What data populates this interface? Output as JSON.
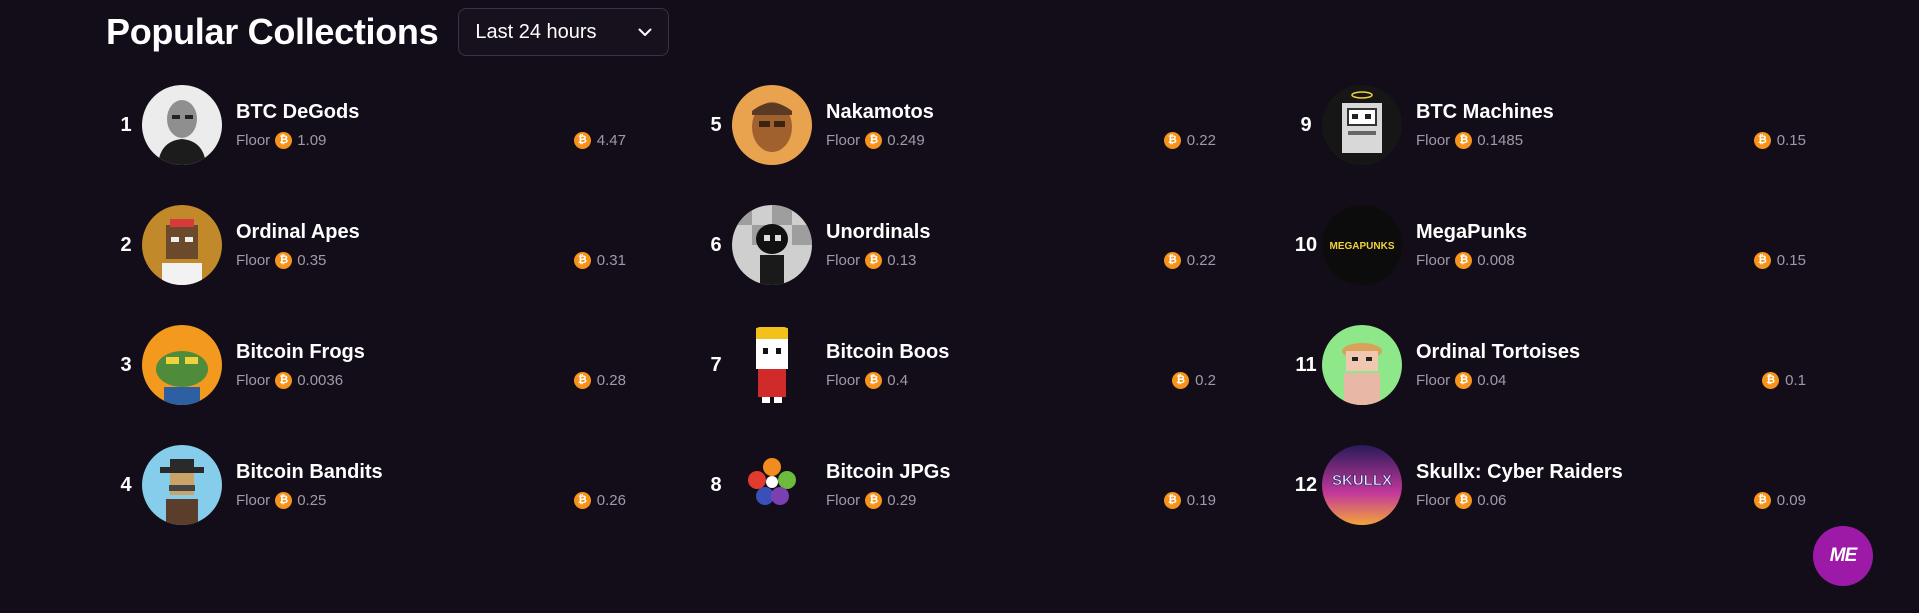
{
  "page": {
    "title": "Popular Collections"
  },
  "filter": {
    "selected": "Last 24 hours",
    "icon": "chevron-down-icon"
  },
  "currency_icon": "bitcoin-icon",
  "accent": "#f7931a",
  "collections": [
    {
      "rank": "1",
      "name": "BTC DeGods",
      "floor_label": "Floor",
      "floor": "1.09",
      "volume": "4.47"
    },
    {
      "rank": "2",
      "name": "Ordinal Apes",
      "floor_label": "Floor",
      "floor": "0.35",
      "volume": "0.31"
    },
    {
      "rank": "3",
      "name": "Bitcoin Frogs",
      "floor_label": "Floor",
      "floor": "0.0036",
      "volume": "0.28"
    },
    {
      "rank": "4",
      "name": "Bitcoin Bandits",
      "floor_label": "Floor",
      "floor": "0.25",
      "volume": "0.26"
    },
    {
      "rank": "5",
      "name": "Nakamotos",
      "floor_label": "Floor",
      "floor": "0.249",
      "volume": "0.22"
    },
    {
      "rank": "6",
      "name": "Unordinals",
      "floor_label": "Floor",
      "floor": "0.13",
      "volume": "0.22"
    },
    {
      "rank": "7",
      "name": "Bitcoin Boos",
      "floor_label": "Floor",
      "floor": "0.4",
      "volume": "0.2"
    },
    {
      "rank": "8",
      "name": "Bitcoin JPGs",
      "floor_label": "Floor",
      "floor": "0.29",
      "volume": "0.19"
    },
    {
      "rank": "9",
      "name": "BTC Machines",
      "floor_label": "Floor",
      "floor": "0.1485",
      "volume": "0.15"
    },
    {
      "rank": "10",
      "name": "MegaPunks",
      "floor_label": "Floor",
      "floor": "0.008",
      "volume": "0.15",
      "logo_text": "MEGAPUNKS"
    },
    {
      "rank": "11",
      "name": "Ordinal Tortoises",
      "floor_label": "Floor",
      "floor": "0.04",
      "volume": "0.1"
    },
    {
      "rank": "12",
      "name": "Skullx: Cyber Raiders",
      "floor_label": "Floor",
      "floor": "0.06",
      "volume": "0.09",
      "logo_text": "SKULLX"
    }
  ],
  "fab": {
    "label": "ME"
  }
}
